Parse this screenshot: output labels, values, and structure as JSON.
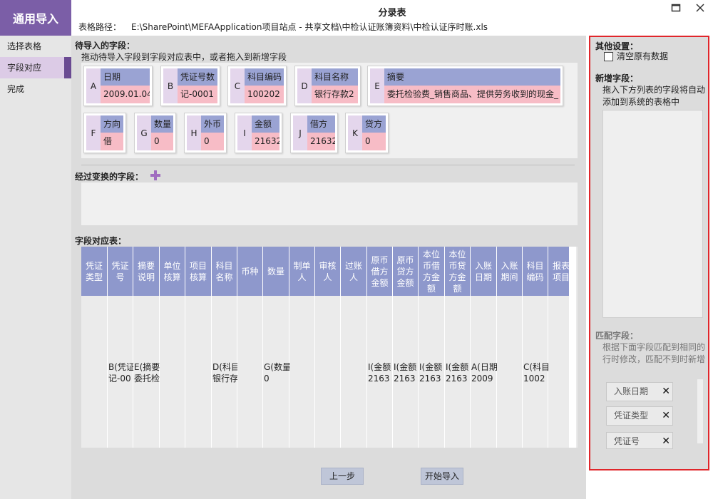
{
  "brand": "通用导入",
  "nav": [
    {
      "label": "选择表格"
    },
    {
      "label": "字段对应"
    },
    {
      "label": "完成"
    }
  ],
  "header": {
    "title": "分录表",
    "path_label": "表格路径：",
    "path": "E:\\SharePoint\\MEFAApplication项目站点 - 共享文档\\中检认证账簿资料\\中检认证序时账.xls"
  },
  "pending": {
    "title": "待导入的字段：",
    "hint": "拖动待导入字段到字段对应表中，或者拖入到新增字段",
    "fields": [
      {
        "letter": "A",
        "name": "日期",
        "value": "2009.01.04"
      },
      {
        "letter": "B",
        "name": "凭证号数",
        "value": "记-0001"
      },
      {
        "letter": "C",
        "name": "科目编码",
        "value": "100202"
      },
      {
        "letter": "D",
        "name": "科目名称",
        "value": "银行存款2"
      },
      {
        "letter": "E",
        "name": "摘要",
        "value": "委托检验费_销售商品、提供劳务收到的现金_"
      },
      {
        "letter": "F",
        "name": "方向",
        "value": "借"
      },
      {
        "letter": "G",
        "name": "数量",
        "value": "0"
      },
      {
        "letter": "H",
        "name": "外币",
        "value": "0"
      },
      {
        "letter": "I",
        "name": "金额",
        "value": "21632"
      },
      {
        "letter": "J",
        "name": "借方",
        "value": "21632"
      },
      {
        "letter": "K",
        "name": "贷方",
        "value": "0"
      }
    ]
  },
  "transform": {
    "title": "经过变换的字段："
  },
  "mapping": {
    "title": "字段对应表：",
    "columns": [
      {
        "header": "凭证\n类型",
        "cell": ""
      },
      {
        "header": "凭证\n号",
        "cell": "B(凭证\n记-00"
      },
      {
        "header": "摘要\n说明",
        "cell": "E(摘要\n委托检"
      },
      {
        "header": "单位\n核算",
        "cell": ""
      },
      {
        "header": "项目\n核算",
        "cell": ""
      },
      {
        "header": "科目\n名称",
        "cell": "D(科目\n银行存"
      },
      {
        "header": "币种",
        "cell": ""
      },
      {
        "header": "数量",
        "cell": "G(数量\n0"
      },
      {
        "header": "制单\n人",
        "cell": ""
      },
      {
        "header": "审核\n人",
        "cell": ""
      },
      {
        "header": "过账\n人",
        "cell": ""
      },
      {
        "header": "原币\n借方\n金额",
        "cell": "I(金额\n2163"
      },
      {
        "header": "原币\n贷方\n金额",
        "cell": "I(金额\n2163"
      },
      {
        "header": "本位\n币借\n方金\n额",
        "cell": "I(金额\n2163"
      },
      {
        "header": "本位\n币贷\n方金\n额",
        "cell": "I(金额\n2163"
      },
      {
        "header": "入账\n日期",
        "cell": "A(日期\n2009"
      },
      {
        "header": "入账\n期间",
        "cell": ""
      },
      {
        "header": "科目\n编码",
        "cell": "C(科目\n1002"
      },
      {
        "header": "报表\n项目",
        "cell": ""
      }
    ]
  },
  "buttons": {
    "prev": "上一步",
    "start": "开始导入"
  },
  "right": {
    "other_title": "其他设置：",
    "clear_label": "清空原有数据",
    "new_title": "新增字段：",
    "new_hint": "拖入下方列表的字段将自动添加到系统的表格中",
    "match_title": "匹配字段：",
    "match_hint": "根据下面字段匹配到相同的行时修改，匹配不到时新增",
    "match_tags": [
      "入账日期",
      "凭证类型",
      "凭证号"
    ]
  },
  "colors": {
    "brand": "#7b5ea7",
    "field_name": "#9aa3d3",
    "field_value": "#f7bcc6",
    "highlight_border": "#e0262b"
  }
}
